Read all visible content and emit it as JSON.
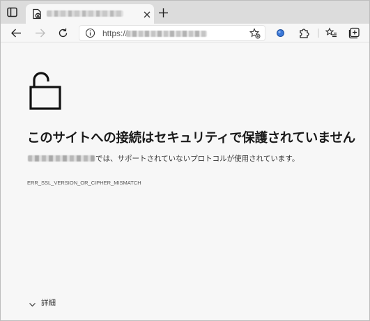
{
  "tab": {
    "favicon": "page-error-icon",
    "close_icon": "close-icon"
  },
  "toolbar": {
    "icons": [
      "tab-actions-icon",
      "back-icon",
      "forward-icon",
      "refresh-icon",
      "info-icon",
      "favorite-star-icon",
      "extension-dot-icon",
      "extensions-puzzle-icon",
      "favorites-list-icon",
      "collections-icon"
    ]
  },
  "address": {
    "scheme": "https://"
  },
  "error": {
    "icon": "open-lock-icon",
    "heading": "このサイトへの接続はセキュリティで保護されていません",
    "description_suffix": "では、サポートされていないプロトコルが使用されています。",
    "code": "ERR_SSL_VERSION_OR_CIPHER_MISMATCH",
    "details_label": "詳細"
  },
  "colors": {
    "tabstrip_bg": "#dcdcdc",
    "page_bg": "#f7f7f7",
    "text": "#1a1a1a",
    "extension_blue": "#3b78d8"
  }
}
